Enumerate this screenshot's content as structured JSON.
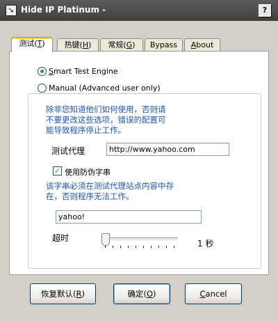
{
  "window": {
    "title": "Hide IP Platinum -",
    "help_label": "?"
  },
  "tabs": [
    {
      "label": "测试(",
      "key": "T",
      "suffix": ")"
    },
    {
      "label": "热键(",
      "key": "H",
      "suffix": ")"
    },
    {
      "label": "常规(",
      "key": "G",
      "suffix": ")"
    },
    {
      "label": "Bypass",
      "key": "",
      "suffix": ""
    },
    {
      "label": "",
      "key": "A",
      "suffix": "bout"
    }
  ],
  "engine": {
    "smart_label_key": "S",
    "smart_label_rest": "mart Test Engine",
    "manual_label": "Manual (Advanced user only)",
    "selected": "smart"
  },
  "manual": {
    "warning_line1": "除非您知道他们如何使用，否则请",
    "warning_line2": "不要更改这些选项，错误的配置可",
    "warning_line3": "能导致程序停止工作。",
    "test_proxy_label": "测试代理",
    "test_proxy_value": "http://www.yahoo.com",
    "antifake_label": "使用防伪字串",
    "antifake_checked": "✓",
    "string_note_line1": "该字串必须在测试代理站点内容中存",
    "string_note_line2": "在，否则程序无法工作。",
    "string_value": "yahoo!",
    "timeout_label": "超时",
    "timeout_value": "1 秒",
    "timeout_level": 0
  },
  "buttons": {
    "restore_label": "恢复默认(",
    "restore_key": "R",
    "ok_label": "确定(",
    "ok_key": "O",
    "cancel_key": "C",
    "cancel_rest": "ancel",
    "close_paren": ")"
  }
}
